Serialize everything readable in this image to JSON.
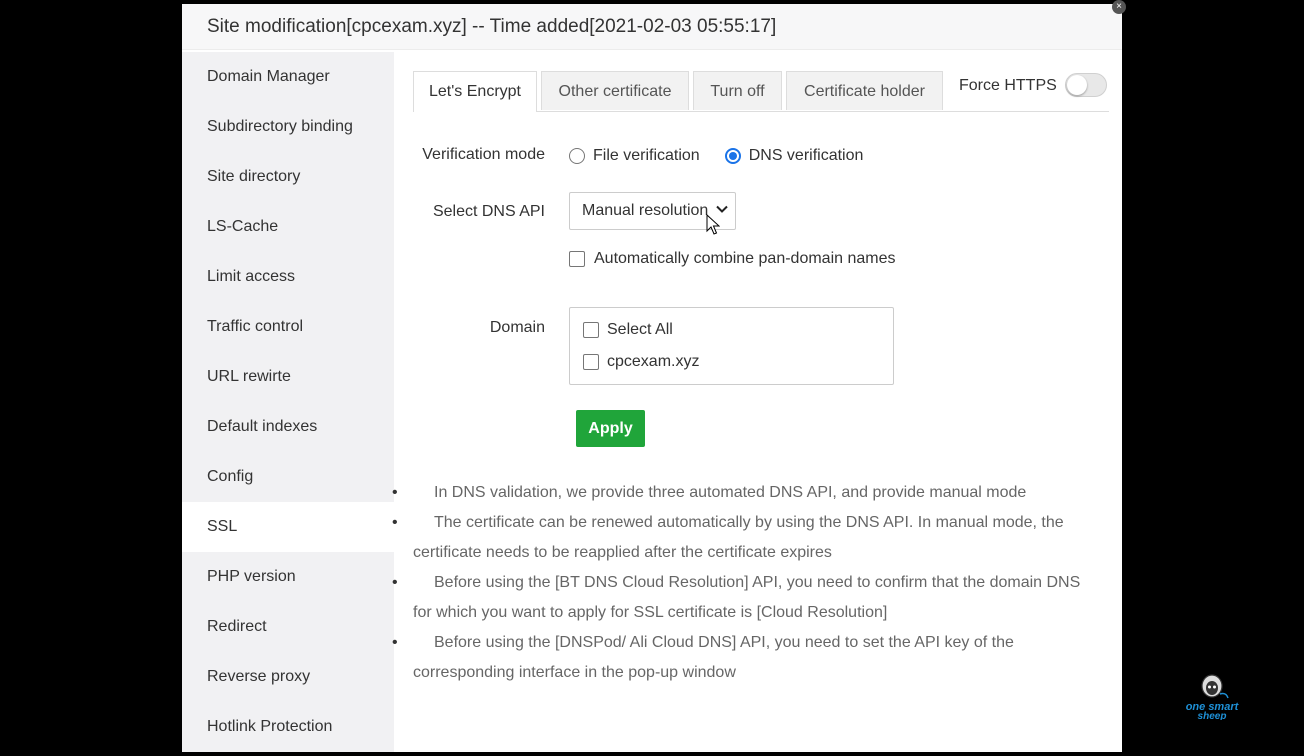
{
  "dialog": {
    "title": "Site modification[cpcexam.xyz] -- Time added[2021-02-03 05:55:17]"
  },
  "sidebar": {
    "items": [
      {
        "label": "Domain Manager"
      },
      {
        "label": "Subdirectory binding"
      },
      {
        "label": "Site directory"
      },
      {
        "label": "LS-Cache"
      },
      {
        "label": "Limit access"
      },
      {
        "label": "Traffic control"
      },
      {
        "label": "URL rewirte"
      },
      {
        "label": "Default indexes"
      },
      {
        "label": "Config"
      },
      {
        "label": "SSL",
        "active": true
      },
      {
        "label": "PHP version"
      },
      {
        "label": "Redirect"
      },
      {
        "label": "Reverse proxy"
      },
      {
        "label": "Hotlink Protection"
      }
    ]
  },
  "tabs": {
    "items": [
      {
        "label": "Let's Encrypt",
        "active": true
      },
      {
        "label": "Other certificate"
      },
      {
        "label": "Turn off"
      },
      {
        "label": "Certificate holder"
      }
    ],
    "force_https_label": "Force HTTPS",
    "force_https_on": false
  },
  "form": {
    "verification_label": "Verification mode",
    "file_verification": "File verification",
    "dns_verification": "DNS verification",
    "selected_mode": "DNS verification",
    "dns_api_label": "Select DNS API",
    "dns_api_value": "Manual resolution",
    "combine_label": "Automatically combine pan-domain names",
    "domain_label": "Domain",
    "select_all": "Select All",
    "domains": [
      "cpcexam.xyz"
    ],
    "apply_label": "Apply"
  },
  "tips": [
    "In DNS validation, we provide three automated DNS API, and provide manual mode",
    "The certificate can be renewed automatically by using the DNS API. In manual mode, the certificate needs to be reapplied after the certificate expires",
    "Before using the [BT DNS Cloud Resolution] API, you need to confirm that the domain DNS for which you want to apply for SSL certificate is [Cloud Resolution]",
    "Before using the [DNSPod/ Ali Cloud DNS] API, you need to set the API key of the corresponding interface in the pop-up window"
  ],
  "watermark": {
    "text": "one smart sheep"
  },
  "colors": {
    "accent": "#20a53a",
    "radio": "#1a73e8",
    "sidebar_bg": "#f1f1f3"
  }
}
